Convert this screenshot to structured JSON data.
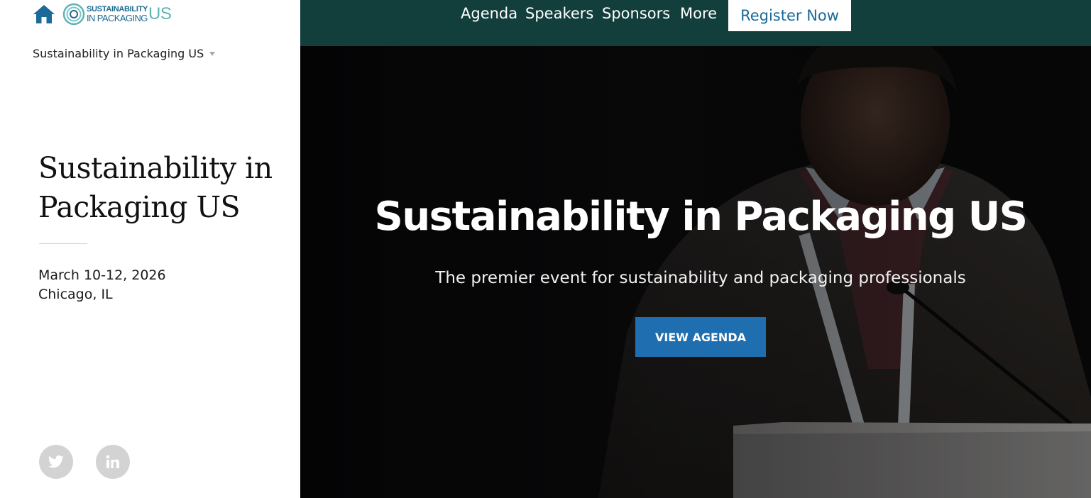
{
  "brand": {
    "logo_top": "SUSTAINABILITY",
    "logo_bottom": "IN PACKAGING",
    "logo_suffix": "US",
    "primary_color": "#1b6a8f",
    "accent_color": "#5fb3b5"
  },
  "sidebar": {
    "site_switcher": "Sustainability in Packaging US",
    "event_title": "Sustainability in Packaging US",
    "event_date": "March 10-12, 2026",
    "event_location": "Chicago, IL",
    "social": [
      {
        "icon": "twitter-icon"
      },
      {
        "icon": "linkedin-icon"
      }
    ]
  },
  "nav": {
    "items": [
      "Agenda",
      "Speakers",
      "Sponsors",
      "More"
    ],
    "register_label": "Register Now",
    "bar_color": "#123f3c"
  },
  "hero": {
    "title": "Sustainability in Packaging US",
    "subtitle": "The premier event for sustainability and packaging professionals",
    "cta_label": "VIEW AGENDA",
    "cta_color": "#1f6fb0"
  }
}
